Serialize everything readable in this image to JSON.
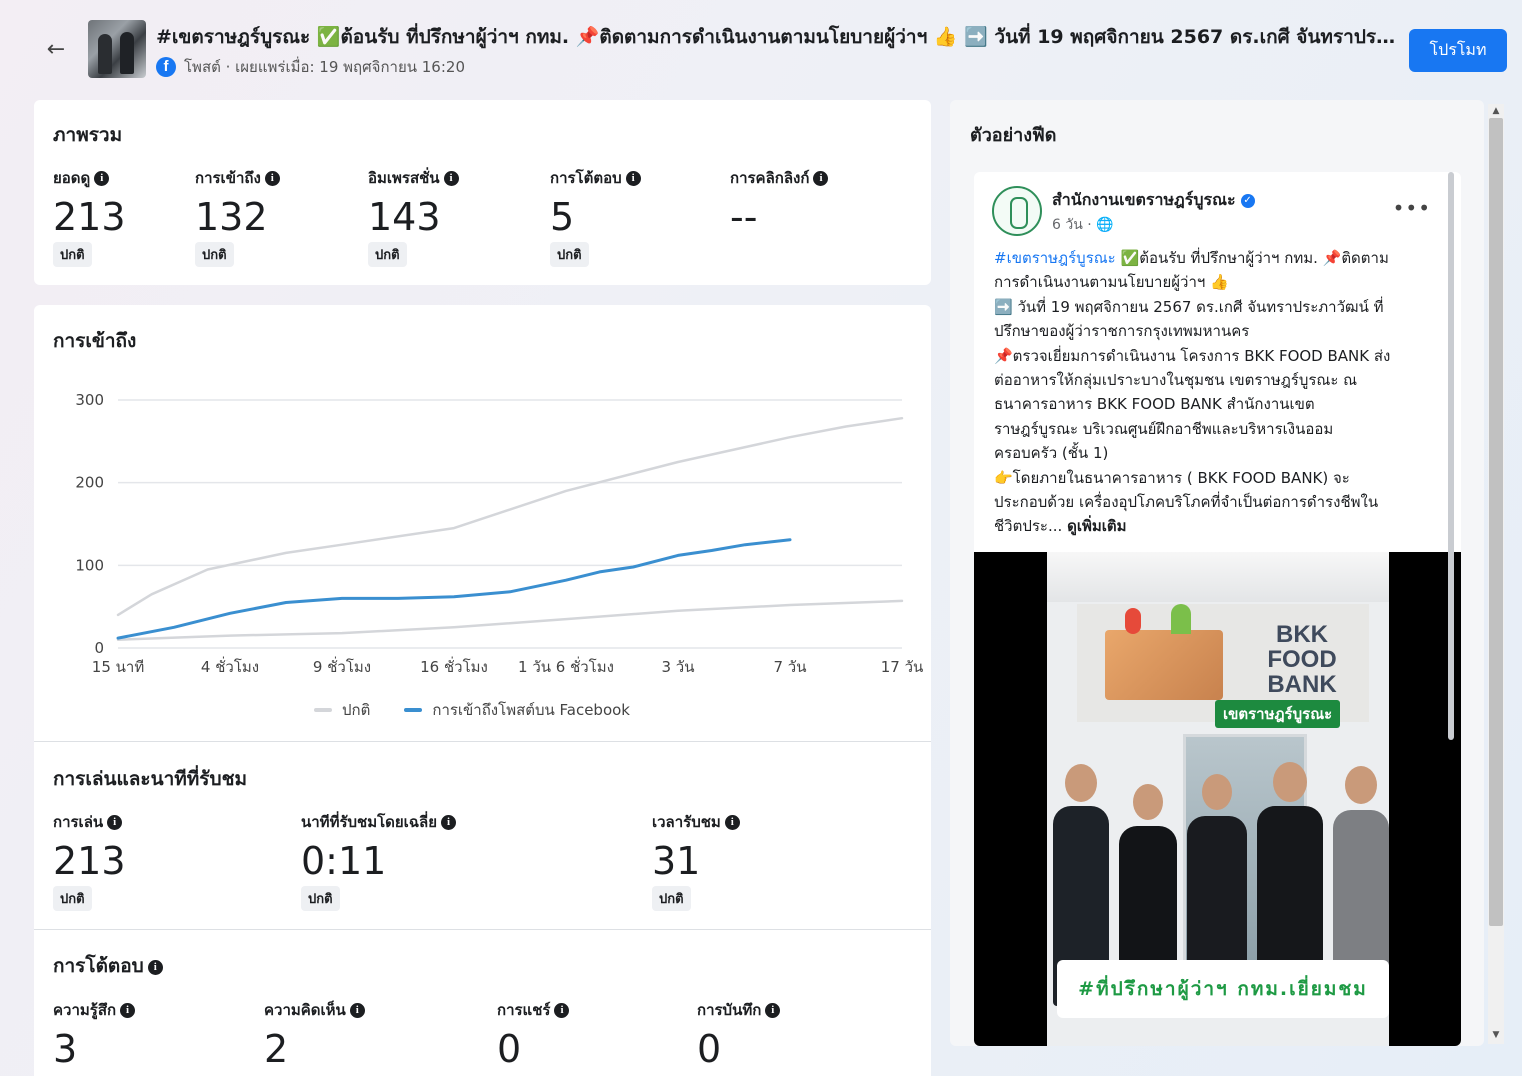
{
  "header": {
    "back_icon": "arrow-left-icon",
    "title": "#เขตราษฎร์บูรณะ ✅ต้อนรับ ที่ปรึกษาผู้ว่าฯ กทม. 📌ติดตามการดำเนินงานตามนโยบายผู้ว่าฯ 👍 ➡️ วันที่ 19 พฤศจิกายน 2567 ดร.เกศี จันทราประภาวัฒน์ ที่ปรึกษาของผู้ว่าราชการกรุงเทพมหานคร",
    "meta": "โพสต์ · เผยแพร่เมื่อ: 19 พฤศจิกายน 16:20",
    "promote_label": "โปรโมท"
  },
  "overview": {
    "title": "ภาพรวม",
    "metrics": [
      {
        "label": "ยอดดู",
        "value": "213",
        "badge": "ปกติ"
      },
      {
        "label": "การเข้าถึง",
        "value": "132",
        "badge": "ปกติ"
      },
      {
        "label": "อิมเพรสชั่น",
        "value": "143",
        "badge": "ปกติ"
      },
      {
        "label": "การโต้ตอบ",
        "value": "5",
        "badge": "ปกติ"
      },
      {
        "label": "การคลิกลิงก์",
        "value": "--",
        "badge": ""
      }
    ]
  },
  "reach": {
    "title": "การเข้าถึง",
    "legend": [
      {
        "label": "ปกติ",
        "color": "#d4d6da"
      },
      {
        "label": "การเข้าถึงโพสต์บน Facebook",
        "color": "#3a8fd0"
      }
    ]
  },
  "chart_data": {
    "type": "line",
    "title": "การเข้าถึง",
    "x_ticks": [
      "15 นาที",
      "4 ชั่วโมง",
      "9 ชั่วโมง",
      "16 ชั่วโมง",
      "1 วัน 6 ชั่วโมง",
      "3 วัน",
      "7 วัน",
      "17 วัน"
    ],
    "y_ticks": [
      0,
      100,
      200,
      300
    ],
    "ylim": [
      0,
      300
    ],
    "grid": true,
    "legend_position": "bottom-center",
    "series": [
      {
        "name": "ปกติ",
        "color": "#d4d6da",
        "x": [
          0,
          0.3,
          0.8,
          1.5,
          2,
          3,
          4,
          5,
          6,
          6.5,
          7
        ],
        "values": [
          40,
          65,
          95,
          115,
          125,
          145,
          190,
          225,
          255,
          268,
          278
        ]
      },
      {
        "name": "ปกติ",
        "color": "#d4d6da",
        "x": [
          0,
          1,
          2,
          3,
          4,
          5,
          6,
          7
        ],
        "values": [
          10,
          15,
          18,
          25,
          35,
          45,
          52,
          57
        ]
      },
      {
        "name": "การเข้าถึงโพสต์บน Facebook",
        "color": "#3a8fd0",
        "x": [
          0,
          0.5,
          1,
          1.5,
          2,
          2.5,
          3,
          3.5,
          4,
          4.3,
          4.6,
          5,
          5.3,
          5.6,
          6.0
        ],
        "values": [
          12,
          25,
          42,
          55,
          60,
          60,
          62,
          68,
          82,
          92,
          98,
          112,
          118,
          125,
          131
        ]
      }
    ]
  },
  "plays": {
    "title": "การเล่นและนาทีที่รับชม",
    "metrics": [
      {
        "label": "การเล่น",
        "value": "213",
        "badge": "ปกติ"
      },
      {
        "label": "นาทีที่รับชมโดยเฉลี่ย",
        "value": "0:11",
        "badge": "ปกติ"
      },
      {
        "label": "เวลารับชม",
        "value": "31",
        "badge": "ปกติ"
      }
    ]
  },
  "engagement": {
    "title": "การโต้ตอบ",
    "metrics": [
      {
        "label": "ความรู้สึก",
        "value": "3"
      },
      {
        "label": "ความคิดเห็น",
        "value": "2"
      },
      {
        "label": "การแชร์",
        "value": "0"
      },
      {
        "label": "การบันทึก",
        "value": "0"
      }
    ]
  },
  "feed": {
    "title": "ตัวอย่างฟีด",
    "page_name": "สำนักงานเขตราษฎร์บูรณะ",
    "time": "6 วัน · 🌐",
    "more_label": "•••",
    "lines": [
      "✅ต้อนรับ ที่ปรึกษาผู้ว่าฯ กทม. 📌ติดตาม",
      "การดำเนินงานตามนโยบายผู้ว่าฯ 👍",
      "➡️ วันที่ 19 พฤศจิกายน 2567 ดร.เกศี จันทราประภาวัฒน์ ที่",
      "ปรึกษาของผู้ว่าราชการกรุงเทพมหานคร",
      "📌ตรวจเยี่ยมการดำเนินงาน โครงการ BKK FOOD BANK ส่ง",
      "ต่ออาหารให้กลุ่มเปราะบางในชุมชน เขตราษฎร์บูรณะ ณ",
      "ธนาคารอาหาร BKK FOOD BANK  สำนักงานเขต",
      "ราษฎร์บูรณะ บริเวณศูนย์ฝึกอาชีพและบริหารเงินออม",
      "ครอบครัว (ชั้น 1)",
      "👉โดยภายในธนาคารอาหาร ( BKK FOOD BANK) จะ",
      "ประกอบด้วย เครื่องอุปโภคบริโภคที่จำเป็นต่อการดำรงชีพใน"
    ],
    "hashtag": "#เขตราษฎร์บูรณะ",
    "last_line": "ชีวิตประ...",
    "see_more": "ดูเพิ่มเติม",
    "image_banner": "BKK FOOD BANK",
    "image_tag": "เขตราษฎร์บูรณะ",
    "image_caption": "#ที่ปรึกษาผู้ว่าฯ กทม.เยี่ยมชม"
  }
}
